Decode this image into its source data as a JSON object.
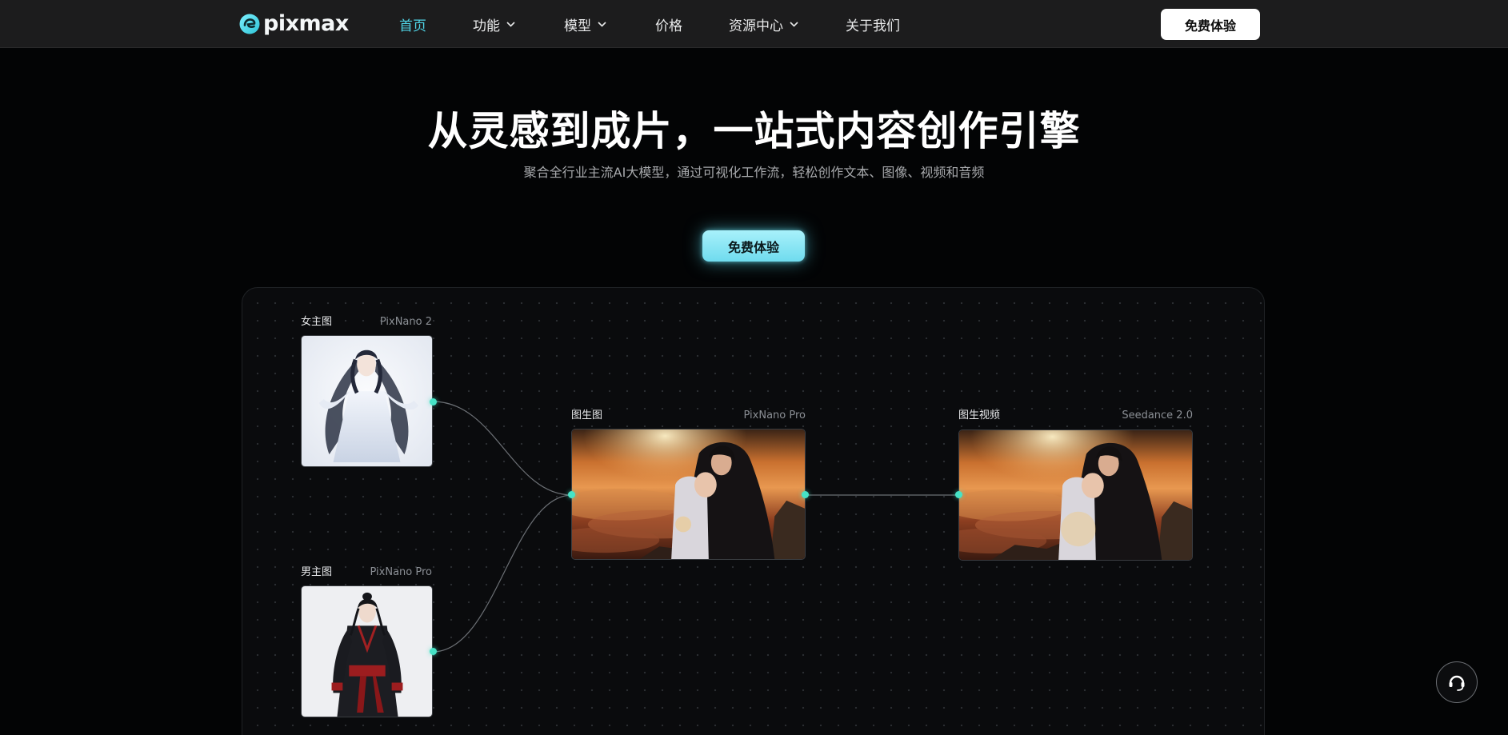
{
  "brand": {
    "name": "pixmax",
    "accent": "#4fd4e6",
    "port_color": "#46e3c6"
  },
  "nav": {
    "items": [
      {
        "label": "首页",
        "active": true,
        "has_dropdown": false
      },
      {
        "label": "功能",
        "active": false,
        "has_dropdown": true
      },
      {
        "label": "模型",
        "active": false,
        "has_dropdown": true
      },
      {
        "label": "价格",
        "active": false,
        "has_dropdown": false
      },
      {
        "label": "资源中心",
        "active": false,
        "has_dropdown": true
      },
      {
        "label": "关于我们",
        "active": false,
        "has_dropdown": false
      }
    ],
    "cta_label": "免费体验"
  },
  "hero": {
    "title": "从灵感到成片，一站式内容创作引擎",
    "subtitle": "聚合全行业主流AI大模型，通过可视化工作流，轻松创作文本、图像、视频和音频",
    "cta_label": "免费体验"
  },
  "workflow": {
    "nodes": [
      {
        "id": "female",
        "label": "女主图",
        "model": "PixNano 2"
      },
      {
        "id": "male",
        "label": "男主图",
        "model": "PixNano Pro"
      },
      {
        "id": "img2img",
        "label": "图生图",
        "model": "PixNano Pro"
      },
      {
        "id": "img2video",
        "label": "图生视频",
        "model": "Seedance 2.0"
      }
    ]
  },
  "icons": {
    "support": "headset-icon",
    "dropdown": "chevron-down-icon"
  }
}
